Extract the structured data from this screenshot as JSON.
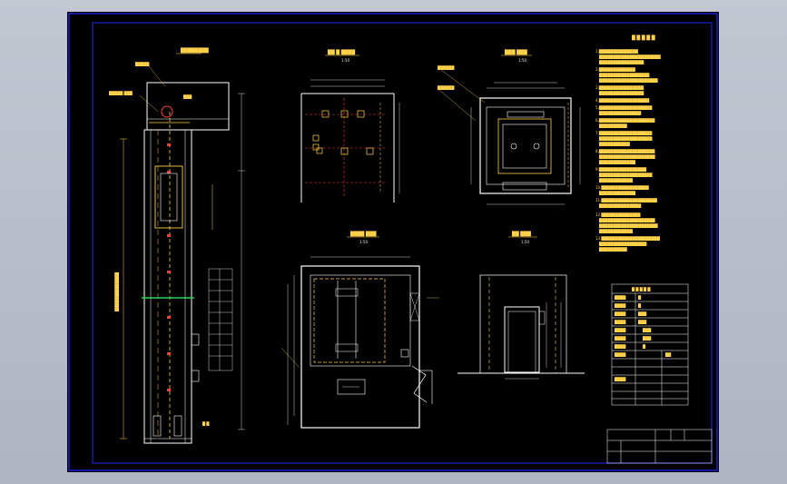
{
  "drawing": {
    "titles": {
      "shaft_section": "████████",
      "top_plan": "██ █ ████",
      "top_plan_scale": "1:50",
      "machine_plan": "███ ███",
      "machine_plan_scale": "1:50",
      "hoistway_plan": "████ ███",
      "hoistway_plan_scale": "1:50",
      "door_elevation": "██ ███",
      "door_elevation_scale": "1:50",
      "notes": "█ █ █ █ █"
    },
    "callouts": {
      "machine": "█████",
      "controller": "█████ ███",
      "pit": "█ █"
    },
    "colors": {
      "frame": "#1f2bff",
      "line": "#ffffff",
      "dim": "#ffd24a",
      "anchor": "#ff3b3b",
      "rail": "#2fd35a",
      "text": "#e6e6e6"
    }
  }
}
